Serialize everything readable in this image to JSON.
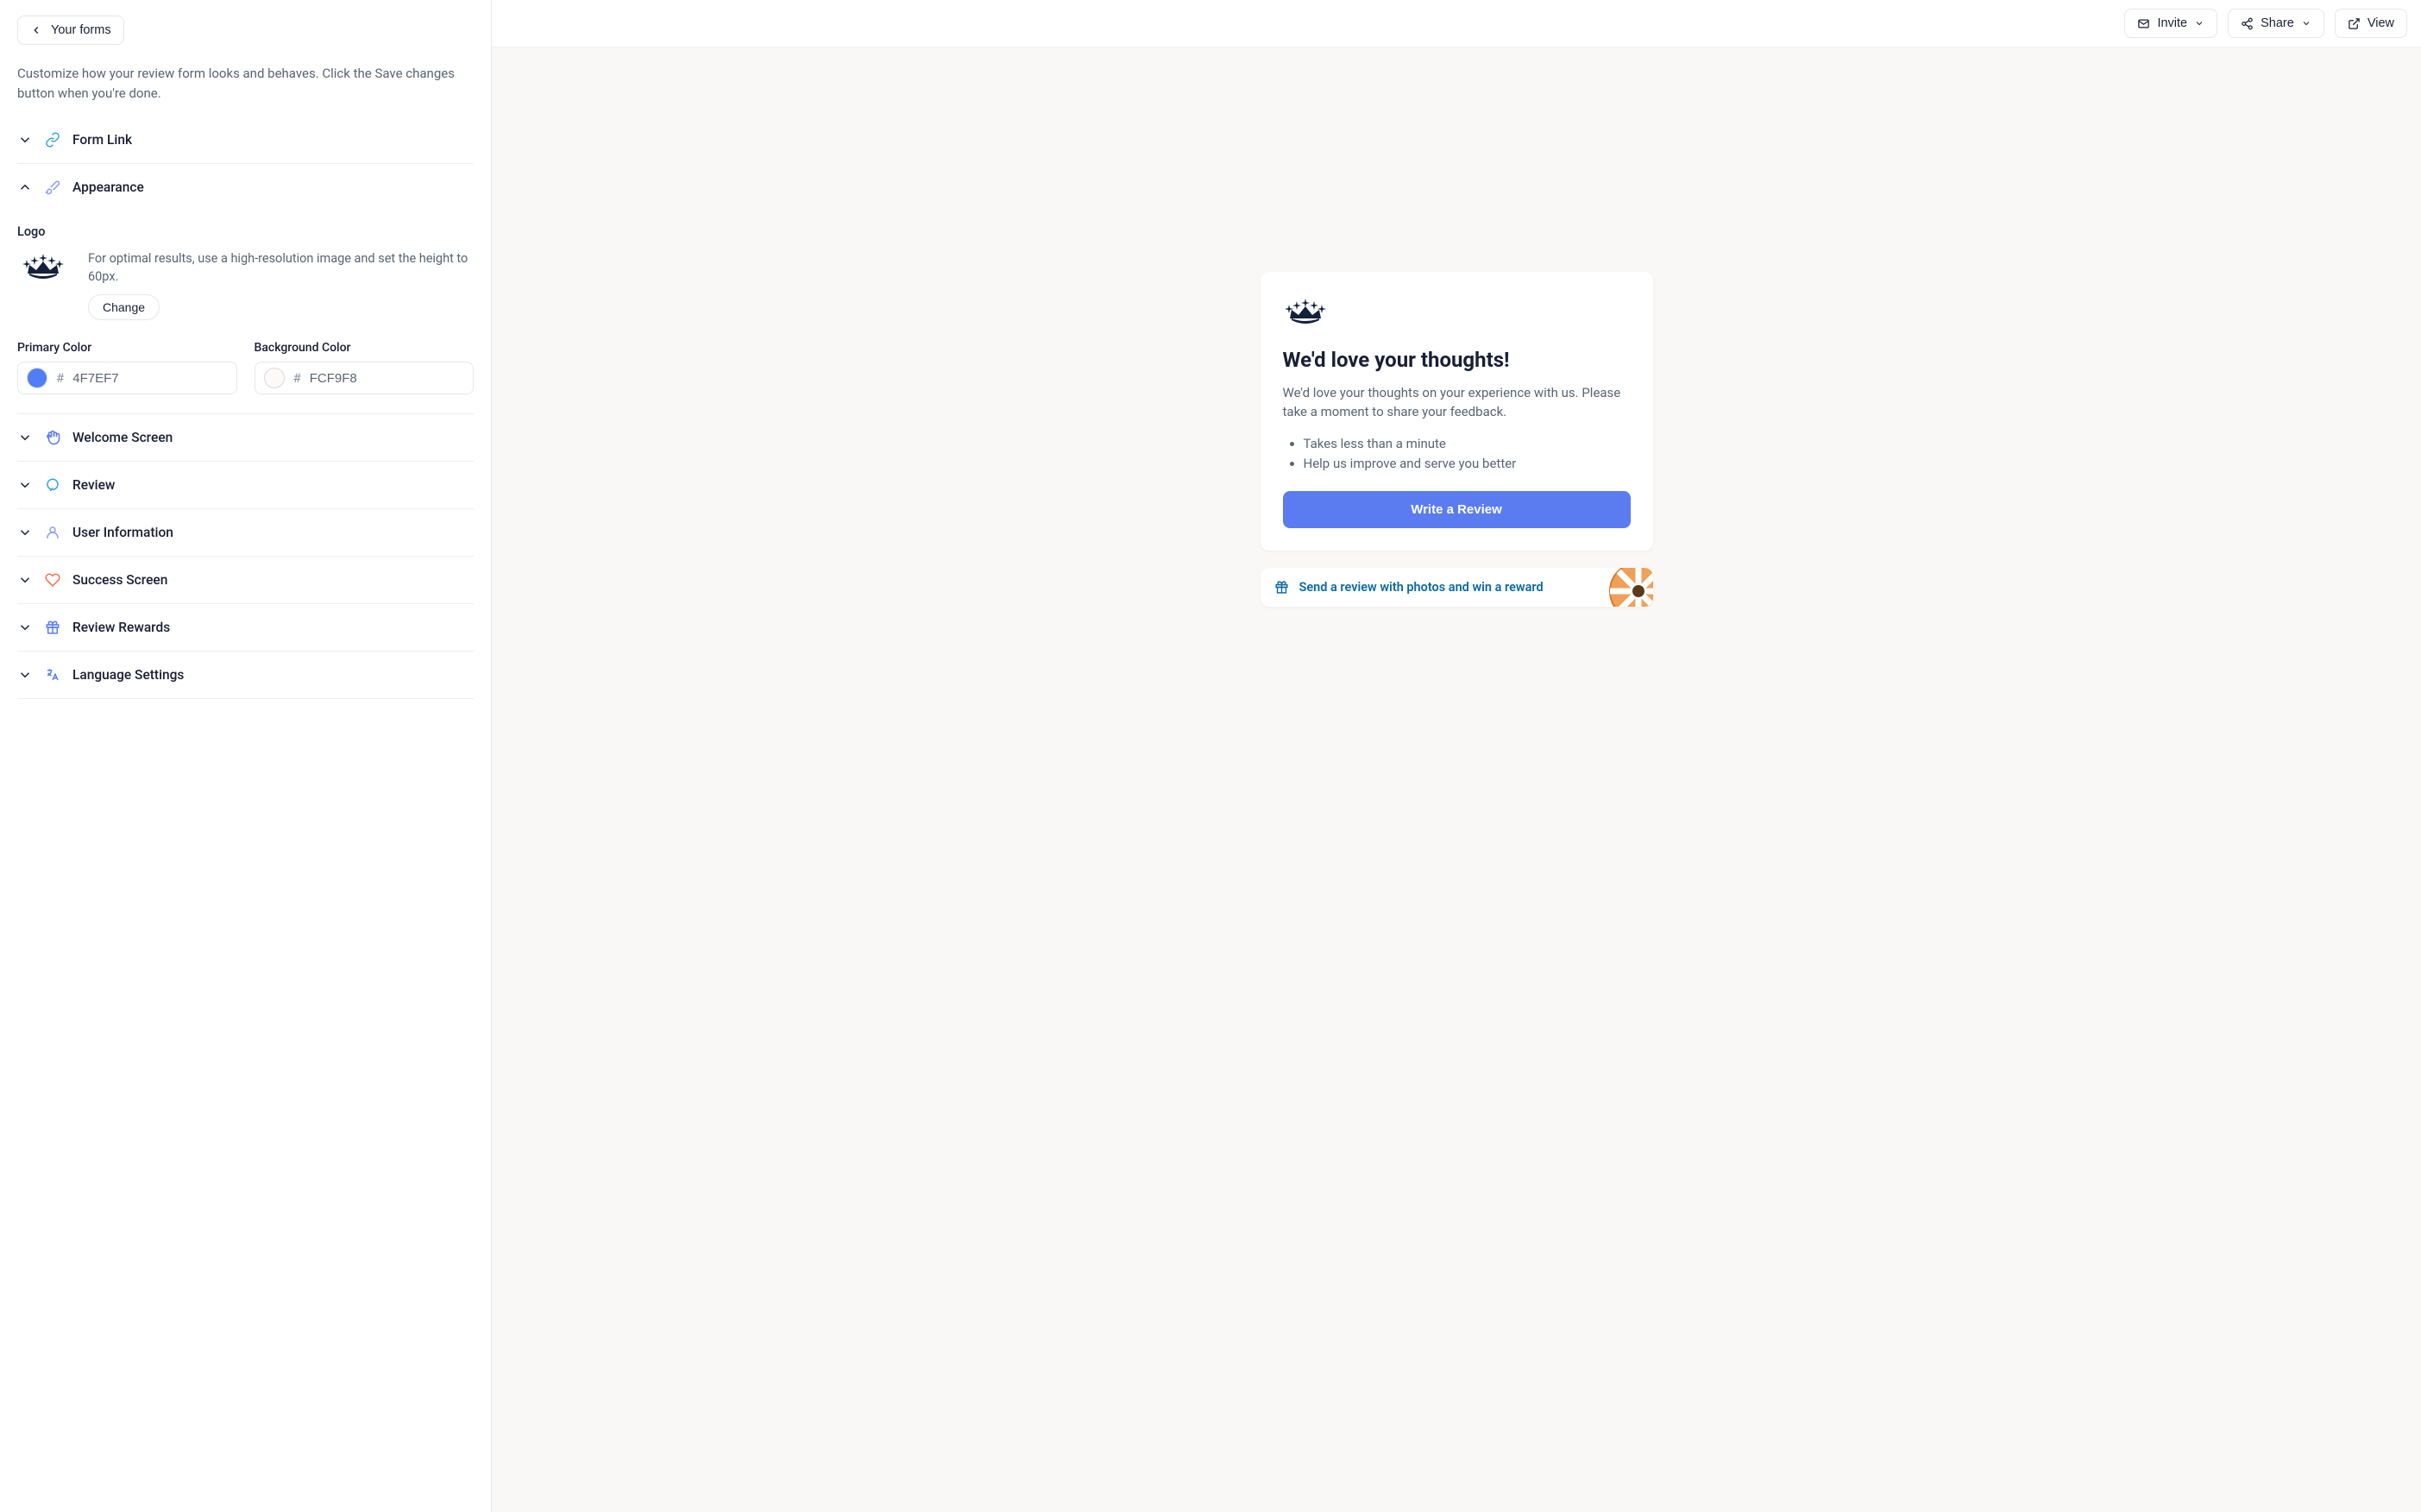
{
  "back_label": "Your forms",
  "description": "Customize how your review form looks and behaves. Click the Save changes button when you're done.",
  "sections": {
    "form_link": {
      "label": "Form Link"
    },
    "appearance": {
      "label": "Appearance",
      "logo_label": "Logo",
      "logo_hint": "For optimal results, use a high-resolution image and set the height to 60px.",
      "change_label": "Change",
      "primary_color_label": "Primary Color",
      "primary_color": "4F7EF7",
      "background_color_label": "Background Color",
      "background_color": "FCF9F8"
    },
    "welcome_screen": {
      "label": "Welcome Screen"
    },
    "review": {
      "label": "Review"
    },
    "user_information": {
      "label": "User Information"
    },
    "success_screen": {
      "label": "Success Screen"
    },
    "review_rewards": {
      "label": "Review Rewards"
    },
    "language_settings": {
      "label": "Language Settings"
    }
  },
  "toolbar": {
    "invite": "Invite",
    "share": "Share",
    "view": "View"
  },
  "preview": {
    "title": "We'd love your thoughts!",
    "body": "We'd love your thoughts on your experience with us. Please take a moment to share your feedback.",
    "bullets": [
      "Takes less than a minute",
      "Help us improve and serve you better"
    ],
    "cta": "Write a Review",
    "reward_text": "Send a review with photos and win a reward"
  },
  "colors": {
    "primary_swatch": "#4F7EF7",
    "background_swatch": "#FCF9F8"
  }
}
